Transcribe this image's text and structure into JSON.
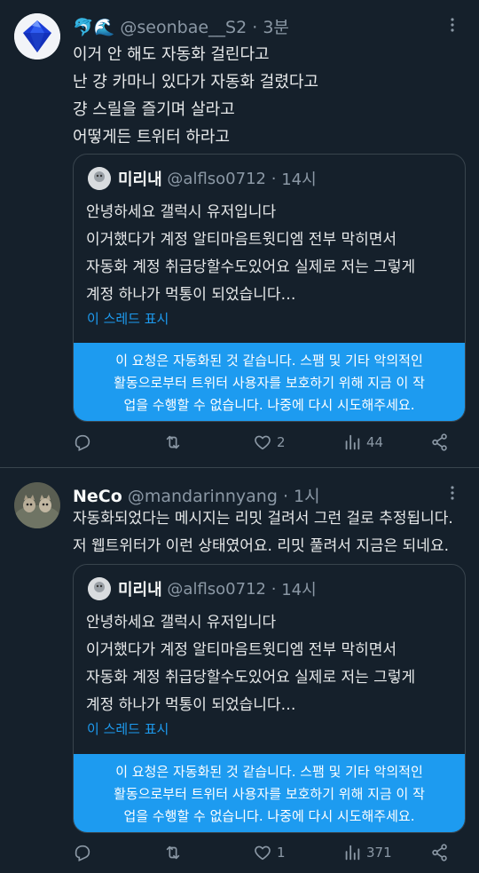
{
  "tweets": [
    {
      "emoji": "🐬🌊",
      "name": "",
      "handle": "@seonbae__S2",
      "dot": "·",
      "time": "3분",
      "lines": [
        "이거 안 해도 자동화 걸린다고",
        "난 걍 카마니 있다가 자동화 걸렸다고",
        "걍 스릴을 즐기며 살라고",
        "어떻게든 트위터 하라고"
      ],
      "quote": {
        "name": "미리내",
        "handle": "@alflso0712",
        "dot": "·",
        "time": "14시",
        "lines": [
          "안녕하세요 갤럭시 유저입니다",
          "이거했다가 계정 알티마음트윗디엠 전부 막히면서",
          "자동화 계정 취급당할수도있어요 실제로 저는 그렇게",
          "계정 하나가 먹통이 되었습니다…"
        ],
        "show_thread": "이 스레드 표시",
        "notice": [
          "이 요청은 자동화된 것 같습니다. 스팸 및 기타 악의적인",
          "활동으로부터 트위터 사용자를 보호하기 위해 지금 이 작",
          "업을 수행할 수 없습니다. 나중에 다시 시도해주세요."
        ]
      },
      "actions": {
        "reply": "",
        "retweet": "",
        "like": "2",
        "views": "44"
      }
    },
    {
      "emoji": "",
      "name": "NeCo",
      "handle": "@mandarinnyang",
      "dot": "·",
      "time": "1시",
      "lines": [
        "자동화되었다는 메시지는 리밋 걸려서 그런 걸로 추정됩니다.",
        "저 웹트위터가 이런 상태였어요. 리밋 풀려서 지금은 되네요."
      ],
      "quote": {
        "name": "미리내",
        "handle": "@alflso0712",
        "dot": "·",
        "time": "14시",
        "lines": [
          "안녕하세요 갤럭시 유저입니다",
          "이거했다가 계정 알티마음트윗디엠 전부 막히면서",
          "자동화 계정 취급당할수도있어요 실제로 저는 그렇게",
          "계정 하나가 먹통이 되었습니다…"
        ],
        "show_thread": "이 스레드 표시",
        "notice": [
          "이 요청은 자동화된 것 같습니다. 스팸 및 기타 악의적인",
          "활동으로부터 트위터 사용자를 보호하기 위해 지금 이 작",
          "업을 수행할 수 없습니다. 나중에 다시 시도해주세요."
        ]
      },
      "actions": {
        "reply": "",
        "retweet": "",
        "like": "1",
        "views": "371"
      }
    }
  ],
  "icons": {
    "reply": "reply-icon",
    "retweet": "retweet-icon",
    "like": "heart-icon",
    "views": "views-icon",
    "share": "share-icon",
    "more": "more-icon"
  },
  "colors": {
    "background": "#15202b",
    "accent": "#1d9bf0",
    "secondary_text": "#8b98a5",
    "border": "#38444d"
  }
}
